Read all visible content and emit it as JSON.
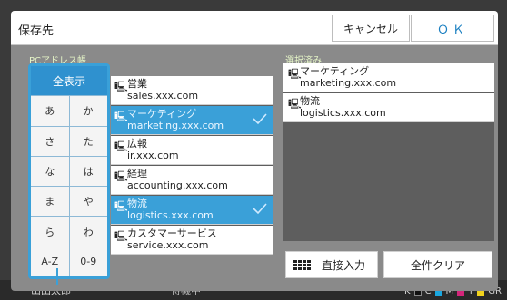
{
  "dialog": {
    "title": "保存先",
    "cancel_label": "キャンセル",
    "ok_label": "ＯＫ"
  },
  "address_book": {
    "label": "PCアドレス帳",
    "index": {
      "all_label": "全表示",
      "keys": [
        "あ",
        "か",
        "さ",
        "た",
        "な",
        "は",
        "ま",
        "や",
        "ら",
        "わ",
        "A-Z",
        "0-9"
      ]
    },
    "entries": [
      {
        "name": "営業",
        "email": "sales.xxx.com",
        "selected": false
      },
      {
        "name": "マーケティング",
        "email": "marketing.xxx.com",
        "selected": true
      },
      {
        "name": "広報",
        "email": "ir.xxx.com",
        "selected": false
      },
      {
        "name": "経理",
        "email": "accounting.xxx.com",
        "selected": false
      },
      {
        "name": "物流",
        "email": "logistics.xxx.com",
        "selected": true
      },
      {
        "name": "カスタマーサービス",
        "email": "service.xxx.com",
        "selected": false
      }
    ]
  },
  "selected": {
    "label": "選択済み",
    "entries": [
      {
        "name": "マーケティング",
        "email": "marketing.xxx.com"
      },
      {
        "name": "物流",
        "email": "logistics.xxx.com"
      }
    ]
  },
  "actions": {
    "direct_input_label": "直接入力",
    "clear_all_label": "全件クリア"
  },
  "status_bar": {
    "user": "山田太郎",
    "status": "待機中",
    "ink": [
      "K",
      "C",
      "M",
      "Y",
      "GR"
    ]
  },
  "colors": {
    "accent": "#3aa0d8",
    "ok_text": "#1a7fc1",
    "section_label": "#e6f6c8"
  }
}
